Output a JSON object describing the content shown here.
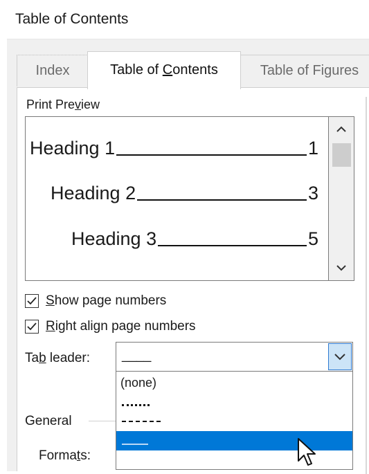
{
  "dialog": {
    "title": "Table of Contents"
  },
  "tabs": [
    {
      "label": "Index",
      "active": false
    },
    {
      "label_pre": "Table of ",
      "label_key": "C",
      "label_post": "ontents",
      "active": true
    },
    {
      "label": "Table of Figures",
      "active": false
    }
  ],
  "preview": {
    "label_pre": "Print Pre",
    "label_key": "v",
    "label_post": "iew",
    "entries": [
      {
        "heading": "Heading 1",
        "page": "1"
      },
      {
        "heading": "Heading 2",
        "page": "3"
      },
      {
        "heading": "Heading 3",
        "page": "5"
      }
    ]
  },
  "options": {
    "show_page_numbers": {
      "key": "S",
      "rest": "how page numbers",
      "checked": true
    },
    "right_align": {
      "key": "R",
      "rest": "ight align page numbers",
      "checked": true
    }
  },
  "tab_leader": {
    "label_pre": "Ta",
    "label_key": "b",
    "label_post": " leader:",
    "selected_value": "____",
    "options": [
      "(none)",
      "dots",
      "dashes",
      "underline"
    ],
    "highlighted_option": "underline"
  },
  "general": {
    "label": "General",
    "formats_pre": "Forma",
    "formats_key": "t",
    "formats_post": "s:"
  },
  "colors": {
    "accent": "#0078d7",
    "arrow_button_bg": "#cce4f7"
  },
  "icons": {
    "scroll_up": "chevron-up-icon",
    "scroll_down": "chevron-down-icon",
    "dropdown": "chevron-down-icon",
    "cursor": "mouse-pointer-icon"
  }
}
